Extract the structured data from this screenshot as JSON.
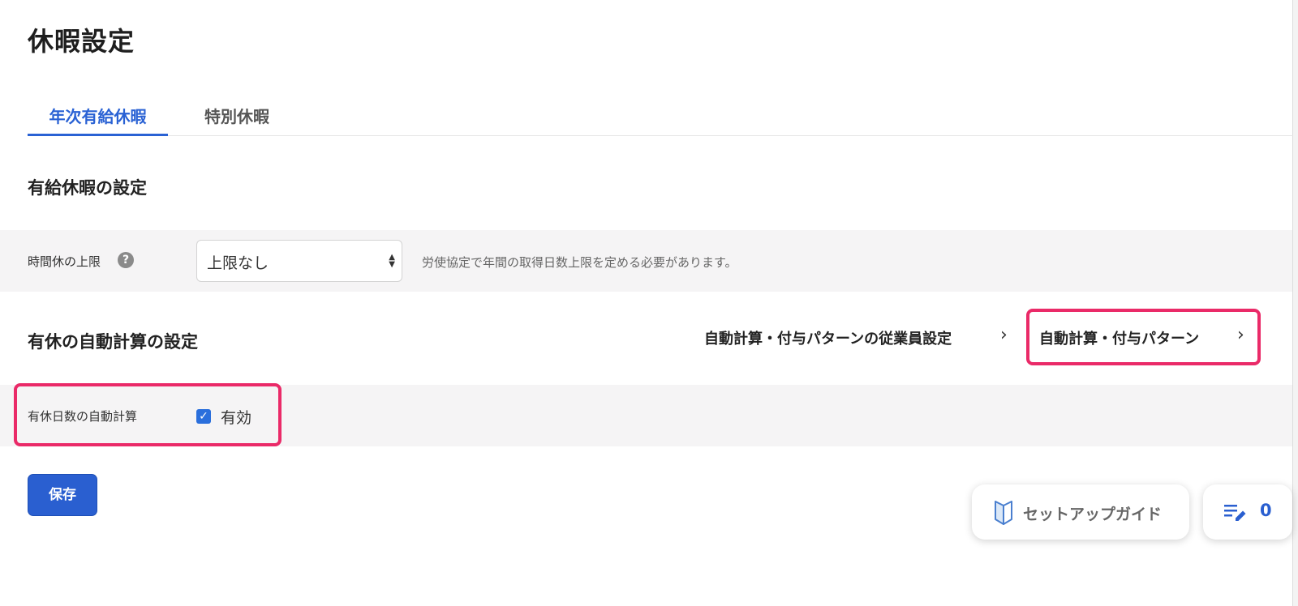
{
  "page": {
    "title": "休暇設定"
  },
  "tabs": [
    {
      "label": "年次有給休暇",
      "active": true
    },
    {
      "label": "特別休暇",
      "active": false
    }
  ],
  "paid_leave": {
    "section_title": "有給休暇の設定",
    "hourly_limit": {
      "label": "時間休の上限",
      "help_icon": "?",
      "select_value": "上限なし",
      "hint": "労使協定で年間の取得日数上限を定める必要があります。"
    }
  },
  "auto_calc": {
    "section_title": "有休の自動計算の設定",
    "link_employee": "自動計算・付与パターンの従業員設定",
    "link_pattern": "自動計算・付与パターン",
    "chevron": "›",
    "row_label": "有休日数の自動計算",
    "checkbox_label": "有効",
    "checked": true
  },
  "actions": {
    "save_label": "保存"
  },
  "floating": {
    "guide_label": "セットアップガイド",
    "notes_count": "0"
  },
  "colors": {
    "accent": "#2a62d4",
    "highlight": "#ea2a68",
    "row_bg": "#f5f4f5"
  }
}
